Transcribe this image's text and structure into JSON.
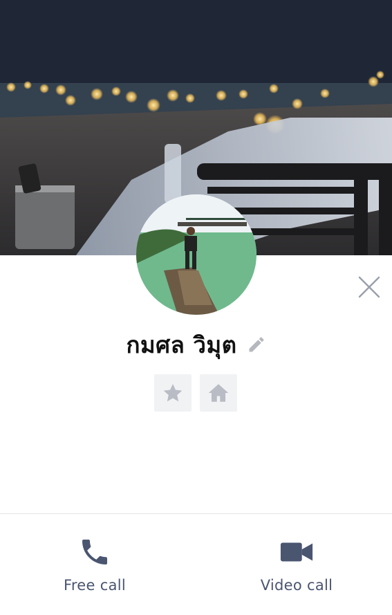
{
  "profile": {
    "name": "กมศล วิมุต"
  },
  "icons": {
    "close": "close-icon",
    "edit": "pencil-icon",
    "favorite": "star-icon",
    "home": "home-icon",
    "voice_call": "phone-icon",
    "video_call": "video-camera-icon"
  },
  "actions": {
    "free_call_label": "Free call",
    "video_call_label": "Video call"
  },
  "colors": {
    "accent": "#4a5570",
    "tile_bg": "#f1f2f4",
    "tile_icon": "#b9bcc4",
    "close_icon": "#9aa0ab",
    "edit_icon": "#b5b8be",
    "divider": "#e3e4e7"
  }
}
